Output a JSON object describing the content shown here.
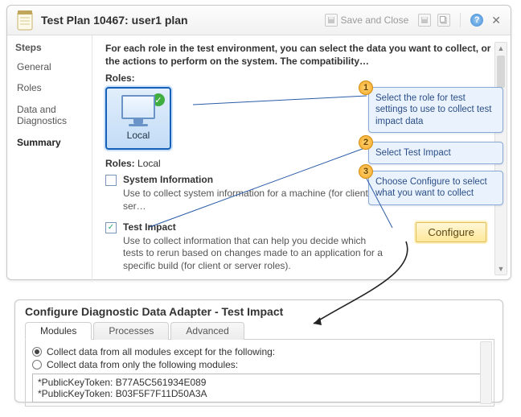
{
  "title": "Test Plan 10467: user1 plan",
  "toolbar": {
    "save_close": "Save and Close"
  },
  "sidebar": {
    "header": "Steps",
    "items": [
      {
        "label": "General"
      },
      {
        "label": "Roles"
      },
      {
        "label": "Data and Diagnostics"
      },
      {
        "label": "Summary"
      }
    ],
    "selected_index": 3
  },
  "content": {
    "intro": "For each role in the test environment, you can select the data you want to collect, or the actions to perform on the system. The compatibility…",
    "roles_label": "Roles:",
    "role_tile": {
      "label": "Local"
    },
    "roles_selected_label": "Roles:",
    "roles_selected_value": "Local",
    "adapters": [
      {
        "checked": false,
        "title": "System Information",
        "desc": "Use to collect system information for a machine (for client or ser…"
      },
      {
        "checked": true,
        "title": "Test Impact",
        "desc": "Use to collect information that can help you decide which tests to rerun based on changes made to an application for a specific build (for client or server roles)."
      }
    ],
    "configure_label": "Configure"
  },
  "callouts": {
    "c1": "Select the role for test settings to use to collect test impact data",
    "c2": "Select Test Impact",
    "c3": "Choose Configure to select what you want to collect"
  },
  "dialog": {
    "title": "Configure Diagnostic Data Adapter - Test Impact",
    "tabs": [
      "Modules",
      "Processes",
      "Advanced"
    ],
    "active_tab": 0,
    "radios": [
      "Collect data from all modules except for the following:",
      "Collect data from only the following modules:"
    ],
    "selected_radio": 0,
    "textlines": [
      "*PublicKeyToken: B77A5C561934E089",
      "*PublicKeyToken: B03F5F7F11D50A3A"
    ]
  }
}
